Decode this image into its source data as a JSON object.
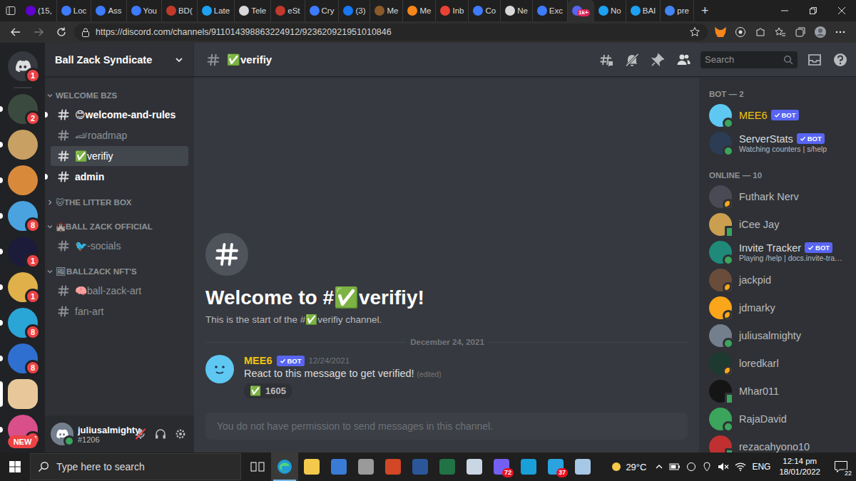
{
  "browser": {
    "tabs": [
      {
        "label": "(15,",
        "kind": "yahoo",
        "selected": false
      },
      {
        "label": "Loc",
        "kind": "ring",
        "selected": false
      },
      {
        "label": "Ass",
        "kind": "ring",
        "selected": false
      },
      {
        "label": "You",
        "kind": "ring",
        "selected": false
      },
      {
        "label": "BD(",
        "kind": "red",
        "selected": false
      },
      {
        "label": "Late",
        "kind": "twitter",
        "selected": false
      },
      {
        "label": "Tele",
        "kind": "doc",
        "selected": false
      },
      {
        "label": "eSt",
        "kind": "red",
        "selected": false
      },
      {
        "label": "Cry",
        "kind": "ring",
        "selected": false
      },
      {
        "label": "(3)",
        "kind": "facebook",
        "selected": false
      },
      {
        "label": "Me",
        "kind": "brown",
        "selected": false
      },
      {
        "label": "Me",
        "kind": "fox",
        "selected": false
      },
      {
        "label": "Inb",
        "kind": "gmail",
        "selected": false
      },
      {
        "label": "Co",
        "kind": "ring",
        "selected": false
      },
      {
        "label": "Ne",
        "kind": "doc",
        "selected": false
      },
      {
        "label": "Exc",
        "kind": "ring",
        "selected": false
      },
      {
        "kind": "discord",
        "selected": true,
        "badge": "1k+"
      },
      {
        "label": "No",
        "kind": "twitter",
        "selected": false
      },
      {
        "label": "BAI",
        "kind": "twitter",
        "selected": false
      },
      {
        "label": "pre",
        "kind": "google",
        "selected": false
      }
    ],
    "new_tab": "+",
    "url": "https://discord.com/channels/911014398863224912/923620921951010846"
  },
  "servers": [
    {
      "kind": "home",
      "badge": "1",
      "unread": false,
      "selected": false,
      "color": "#36393f"
    },
    {
      "kind": "server",
      "badge": "2",
      "unread": true,
      "selected": false,
      "color": "#3b4a3f"
    },
    {
      "kind": "server",
      "unread": true,
      "selected": false,
      "color": "#c9a063"
    },
    {
      "kind": "server",
      "unread": true,
      "selected": false,
      "color": "#d88a3a"
    },
    {
      "kind": "server",
      "badge": "8",
      "unread": true,
      "selected": false,
      "color": "#4aa3df"
    },
    {
      "kind": "server",
      "badge": "1",
      "unread": true,
      "selected": false,
      "color": "#1c1c3a"
    },
    {
      "kind": "server",
      "badge": "1",
      "unread": true,
      "selected": false,
      "color": "#e0b04a"
    },
    {
      "kind": "server",
      "badge": "8",
      "unread": true,
      "selected": false,
      "color": "#2aa6d6"
    },
    {
      "kind": "server",
      "badge": "8",
      "unread": true,
      "selected": false,
      "color": "#2f6fd0"
    },
    {
      "kind": "server",
      "unread": false,
      "selected": true,
      "color": "#e8c89a"
    },
    {
      "kind": "server",
      "badge": "24",
      "unread": true,
      "selected": false,
      "color": "#d94f8a"
    }
  ],
  "rail_new_label": "NEW",
  "server": {
    "name": "Ball Zack Syndicate"
  },
  "categories": [
    {
      "name": "WELCOME BZS",
      "expanded": true,
      "channels": [
        {
          "name": "😊welcome-and-rules",
          "unread": true,
          "selected": false
        },
        {
          "name": "🏎roadmap",
          "unread": false,
          "selected": false
        },
        {
          "name": "✅verifiy",
          "unread": false,
          "selected": true
        },
        {
          "name": "admin",
          "unread": true,
          "selected": false
        }
      ]
    },
    {
      "name": "🐱THE LITTER BOX",
      "expanded": false,
      "channels": []
    },
    {
      "name": "🏰BALL ZACK OFFICIAL",
      "expanded": true,
      "channels": [
        {
          "name": "🐦-socials",
          "unread": false,
          "selected": false
        }
      ]
    },
    {
      "name": "🖼BALLZACK NFT'S",
      "expanded": true,
      "channels": [
        {
          "name": "🧠ball-zack-art",
          "unread": false,
          "selected": false
        },
        {
          "name": "fan-art",
          "unread": false,
          "selected": false
        }
      ]
    }
  ],
  "user": {
    "name": "juliusalmighty",
    "tag": "#1206",
    "muted": true
  },
  "channel": {
    "name": "✅verifiy",
    "search_placeholder": "Search",
    "welcome_title": "Welcome to #✅verifiy!",
    "welcome_text": "This is the start of the #✅verifiy channel.",
    "input_placeholder": "You do not have permission to send messages in this channel."
  },
  "divider": "December 24, 2021",
  "messages": [
    {
      "author": "MEE6",
      "author_color": "#f1c40f",
      "tag": "BOT",
      "time": "12/24/2021",
      "text": "React to this message to get verified!",
      "edited": "(edited)",
      "reactions": [
        {
          "emoji": "✅",
          "count": "1605"
        }
      ]
    }
  ],
  "members": [
    {
      "title": "BOT — 2",
      "items": [
        {
          "name": "MEE6",
          "tag": "BOT",
          "status": "online",
          "color": "#5ec8f2",
          "role_color": "#f1c40f"
        },
        {
          "name": "ServerStats",
          "tag": "BOT",
          "activity": "Watching counters | s/help",
          "status": "online",
          "color": "#2b3c53",
          "role_color": "#dcddde"
        }
      ]
    },
    {
      "title": "ONLINE — 10",
      "items": [
        {
          "name": "Futhark Nerv",
          "status": "idle",
          "color": "#4a4a55",
          "role_color": "#b9bbbe"
        },
        {
          "name": "iCee Jay",
          "status": "mobile",
          "color": "#caa050",
          "role_color": "#b9bbbe"
        },
        {
          "name": "Invite Tracker",
          "tag": "BOT",
          "activity": "Playing /help | docs.invite-tra…",
          "status": "online",
          "color": "#1f8a7a",
          "role_color": "#dcddde"
        },
        {
          "name": "jackpid",
          "status": "idle",
          "color": "#6a4c3a",
          "role_color": "#b9bbbe"
        },
        {
          "name": "jdmarky",
          "status": "idle",
          "color": "#faa61a",
          "role_color": "#b9bbbe"
        },
        {
          "name": "juliusalmighty",
          "status": "online",
          "color": "#747f8d",
          "role_color": "#b9bbbe"
        },
        {
          "name": "loredkarl",
          "status": "idle",
          "color": "#1d3a30",
          "role_color": "#b9bbbe"
        },
        {
          "name": "Mhar011",
          "status": "mobile",
          "color": "#151515",
          "role_color": "#b9bbbe"
        },
        {
          "name": "RajaDavid",
          "status": "online",
          "color": "#3ba55c",
          "role_color": "#b9bbbe"
        },
        {
          "name": "rezacahyono10",
          "status": "mobile",
          "color": "#c03030",
          "role_color": "#b9bbbe"
        }
      ]
    }
  ],
  "taskbar": {
    "search_placeholder": "Type here to search",
    "apps": [
      {
        "kind": "taskview",
        "selected": false
      },
      {
        "kind": "edge",
        "selected": true
      },
      {
        "kind": "explorer",
        "selected": false
      },
      {
        "kind": "photos",
        "selected": false
      },
      {
        "kind": "settings",
        "selected": false
      },
      {
        "kind": "powerpoint",
        "selected": false
      },
      {
        "kind": "word",
        "selected": false
      },
      {
        "kind": "excel",
        "selected": false
      },
      {
        "kind": "paint",
        "selected": false
      },
      {
        "kind": "viber",
        "selected": false,
        "badge": "72"
      },
      {
        "kind": "remote",
        "selected": false
      },
      {
        "kind": "telegram",
        "selected": false,
        "badge": "37"
      },
      {
        "kind": "notes",
        "selected": false
      }
    ],
    "weather": "29°C",
    "language": "ENG",
    "time": "12:14 pm",
    "date": "18/01/2022",
    "notifications": "22"
  }
}
